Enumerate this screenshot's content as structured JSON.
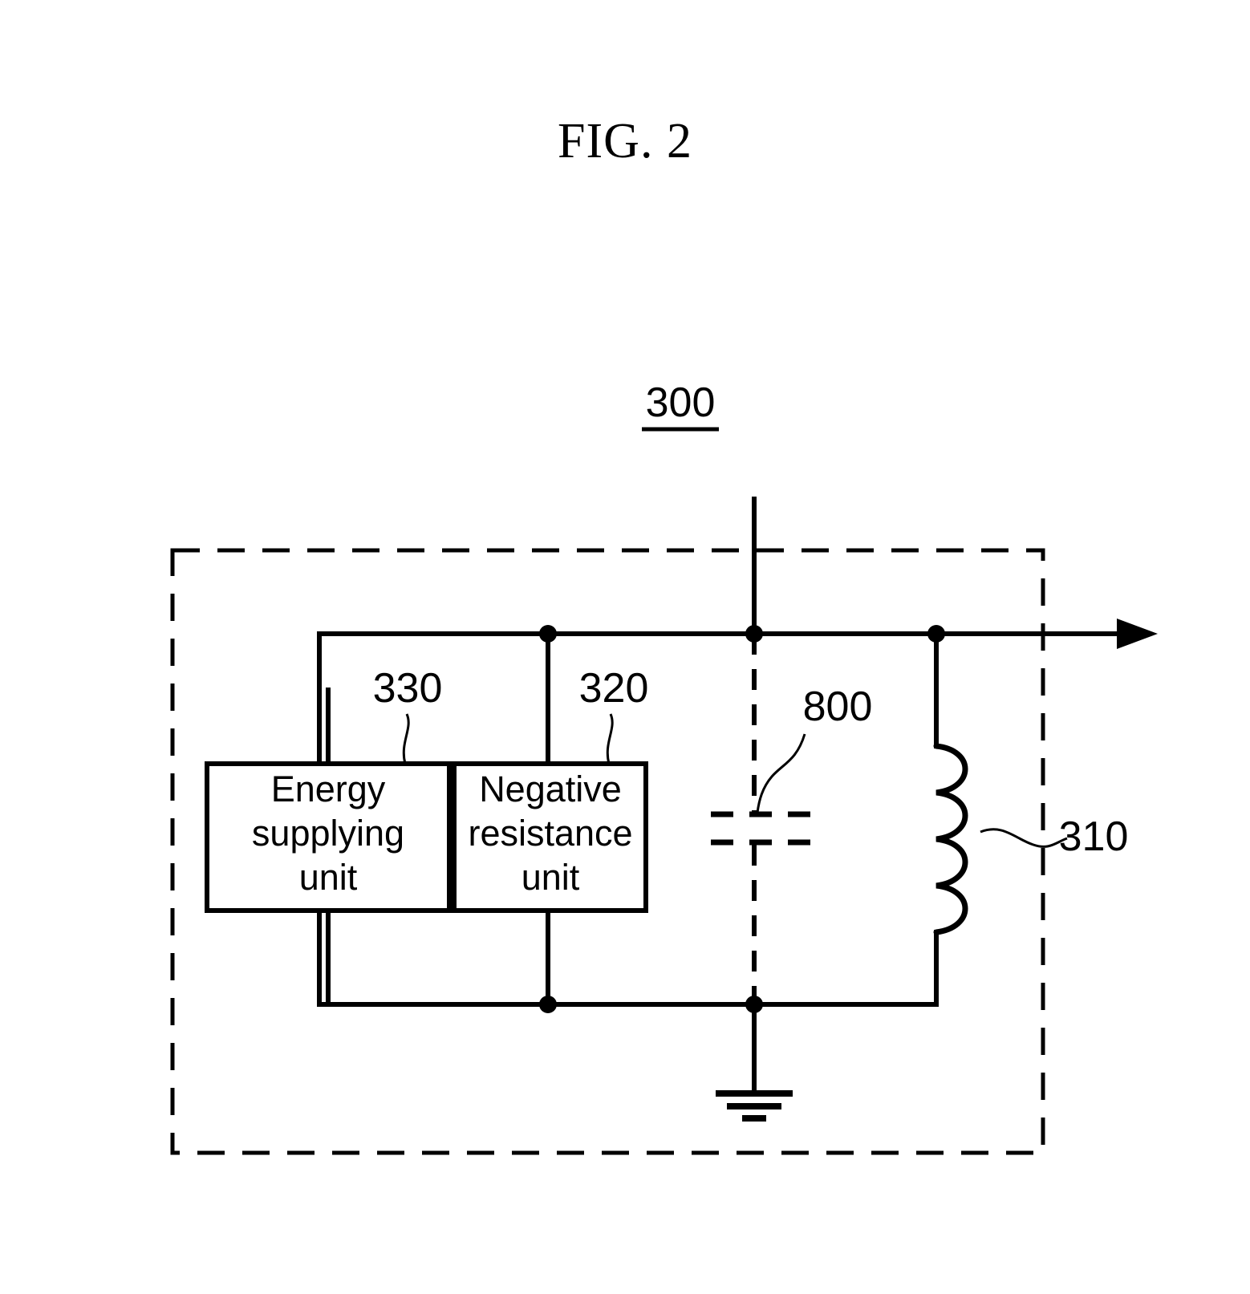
{
  "figure": {
    "title": "FIG. 2",
    "main_reference": "300",
    "type": "patent-circuit-schematic"
  },
  "labels": {
    "assembly": "300",
    "energy_supplying_unit": "330",
    "negative_resistance_unit": "320",
    "capacitor": "800",
    "inductor": "310"
  },
  "blocks": [
    {
      "id": "energy-supplying-unit",
      "ref": "330",
      "lines": [
        "Energy",
        "supplying",
        "unit"
      ]
    },
    {
      "id": "negative-resistance-unit",
      "ref": "320",
      "lines": [
        "Negative",
        "resistance",
        "unit"
      ]
    }
  ],
  "components": [
    {
      "id": "capacitor",
      "ref": "800",
      "symbol": "capacitor-dashed",
      "style": "dashed"
    },
    {
      "id": "inductor",
      "ref": "310",
      "symbol": "inductor-coil",
      "turns": 4
    },
    {
      "id": "ground",
      "symbol": "earth-ground",
      "bars": 3
    },
    {
      "id": "output-terminal",
      "symbol": "arrow-right"
    }
  ],
  "colors": {
    "stroke": "#000000",
    "background": "#ffffff",
    "text": "#000000"
  }
}
